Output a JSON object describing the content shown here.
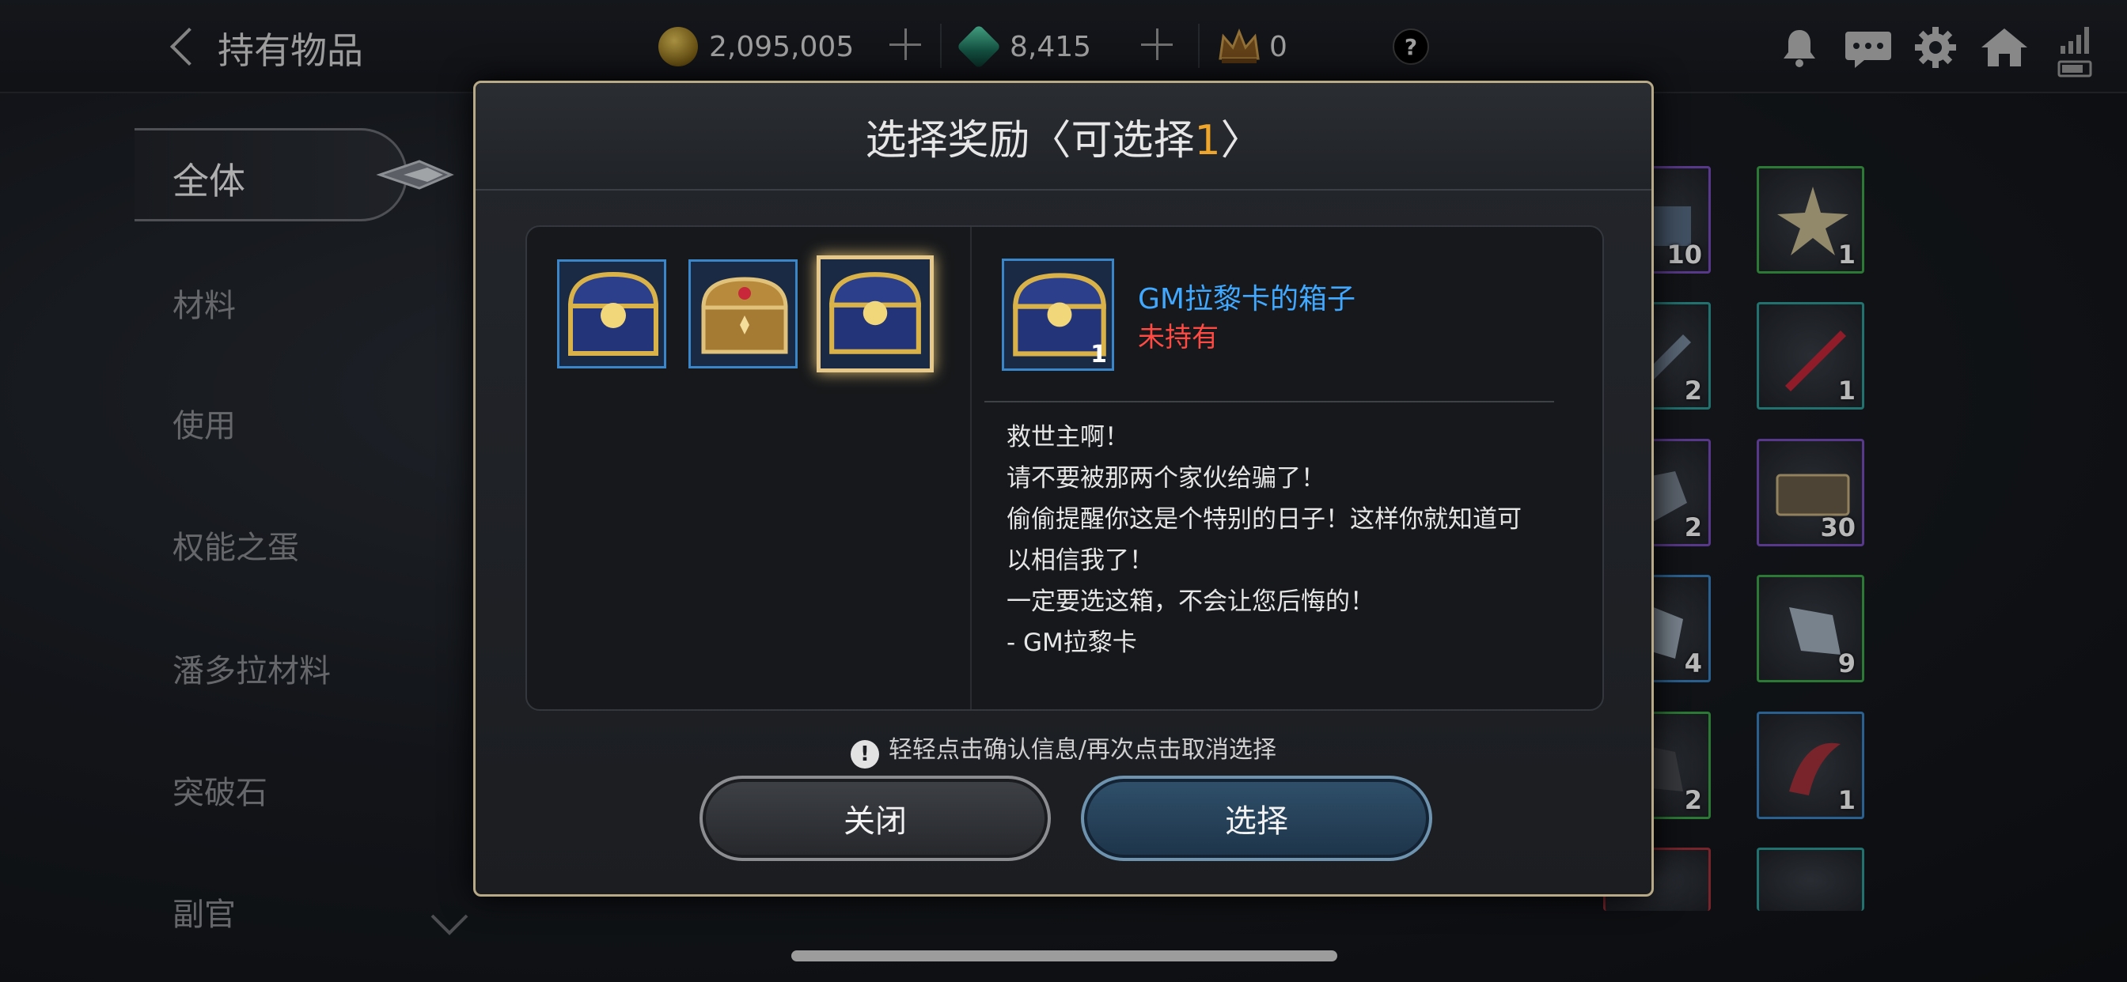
{
  "header": {
    "title": "持有物品",
    "gold": "2,095,005",
    "gems": "8,415",
    "crowns": "0",
    "help": "?"
  },
  "sidebar": {
    "items": [
      {
        "label": "全体",
        "active": true
      },
      {
        "label": "材料"
      },
      {
        "label": "使用"
      },
      {
        "label": "权能之蛋"
      },
      {
        "label": "潘多拉材料"
      },
      {
        "label": "突破石"
      },
      {
        "label": "副官"
      }
    ]
  },
  "grid": {
    "counts": [
      "10",
      "1",
      "2",
      "1",
      "2",
      "30",
      "4",
      "9",
      "2",
      "1"
    ]
  },
  "dialog": {
    "title_prefix": "选择奖励〈可选择",
    "title_num": "1",
    "title_suffix": "〉",
    "options": [
      {
        "name": "chest-blue-gold"
      },
      {
        "name": "chest-gold-red"
      },
      {
        "name": "chest-blue-gold-selected",
        "selected": true
      }
    ],
    "detail": {
      "name": "GM拉黎卡的箱子",
      "status": "未持有",
      "count": "1",
      "description": "救世主啊！\n请不要被那两个家伙给骗了！\n偷偷提醒你这是个特别的日子！这样你就知道可\n以相信我了！\n一定要选这箱，不会让您后悔的！\n- GM拉黎卡"
    },
    "hint": "轻轻点击确认信息/再次点击取消选择",
    "close_label": "关闭",
    "select_label": "选择"
  },
  "colors": {
    "accent_orange": "#f0a52b",
    "item_name_blue": "#41a8ff",
    "status_red": "#ff4a44",
    "dialog_border": "#b8aa86"
  }
}
